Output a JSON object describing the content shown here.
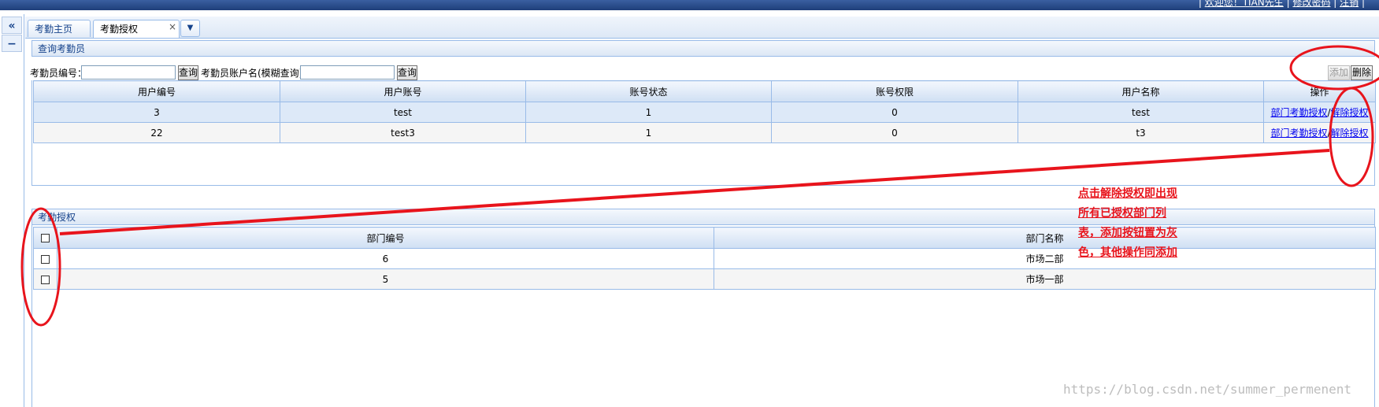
{
  "header": {
    "links": [
      "欢迎您！TIAN先生",
      "修改密码",
      "注销"
    ]
  },
  "left_nav": {
    "collapse_glyph": "«",
    "minus_glyph": "−"
  },
  "tabs": [
    {
      "label": "考勤主页"
    },
    {
      "label": "考勤授权",
      "close": "×"
    }
  ],
  "tab_menu_glyph": "▼",
  "query_panel": {
    "title": "查询考勤员",
    "id_label": "考勤员编号：",
    "id_value": "",
    "query1": "查询",
    "name_label": "考勤员账户名(模糊查询)：",
    "name_value": "",
    "query2": "查询",
    "add": "添加",
    "delete": "删除"
  },
  "user_table": {
    "columns": [
      "用户编号",
      "用户账号",
      "账号状态",
      "账号权限",
      "用户名称",
      "操作"
    ],
    "rows": [
      {
        "id": "3",
        "account": "test",
        "status": "1",
        "permission": "0",
        "name": "test",
        "op1": "部门考勤授权",
        "sep": "/",
        "op2": "解除授权"
      },
      {
        "id": "22",
        "account": "test3",
        "status": "1",
        "permission": "0",
        "name": "t3",
        "op1": "部门考勤授权",
        "sep": "/",
        "op2": "解除授权"
      }
    ]
  },
  "auth_panel": {
    "title": "考勤授权",
    "columns": [
      "部门编号",
      "部门名称"
    ],
    "rows": [
      {
        "dept_id": "6",
        "dept_name": "市场二部"
      },
      {
        "dept_id": "5",
        "dept_name": "市场一部"
      }
    ]
  },
  "annotation": {
    "lines": [
      "点击解除授权即出现",
      "所有已授权部门列",
      "表，添加按钮置为灰",
      "色，其他操作同添加"
    ],
    "color": "#e8141c"
  },
  "watermark": "https://blog.csdn.net/summer_permenent"
}
